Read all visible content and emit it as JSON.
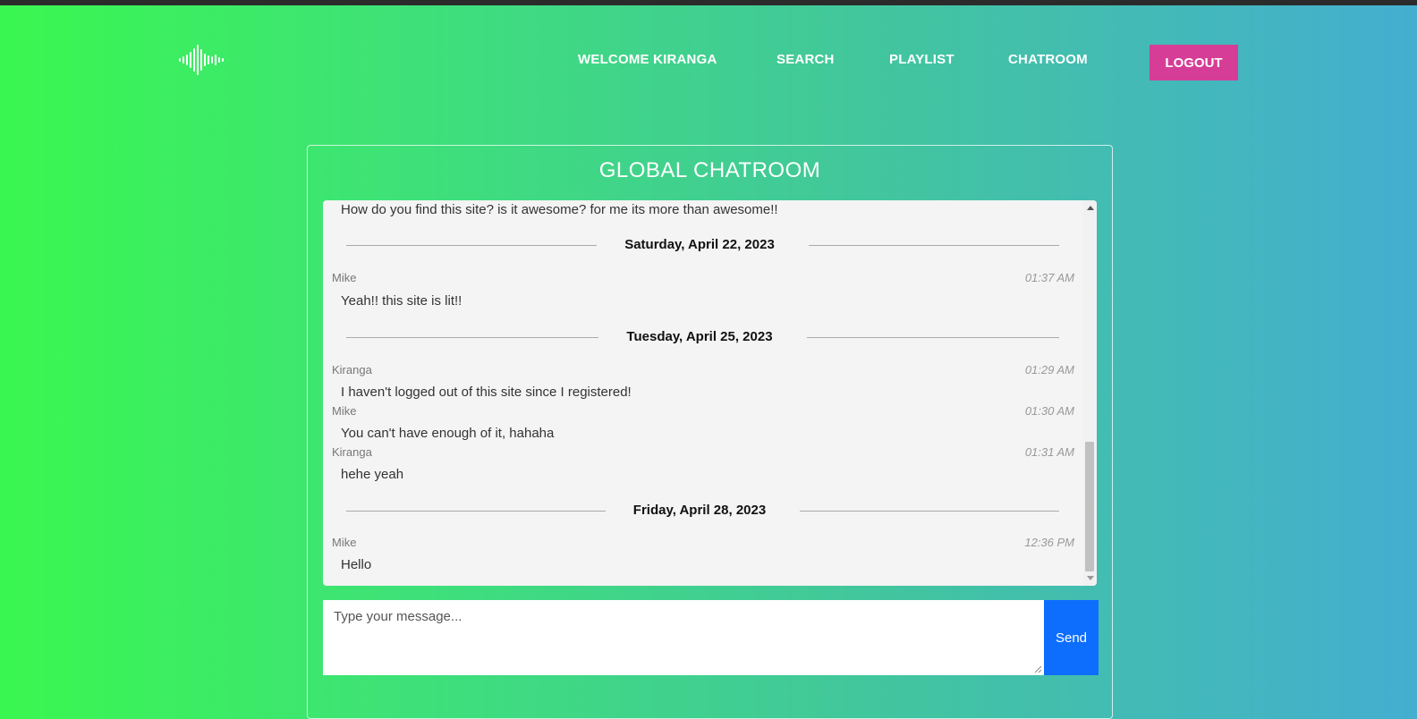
{
  "nav": {
    "welcome": "WELCOME KIRANGA",
    "search": "SEARCH",
    "playlist": "PLAYLIST",
    "chatroom": "CHATROOM",
    "logout": "LOGOUT"
  },
  "chat": {
    "title": "GLOBAL CHATROOM",
    "partial_message": "How do you find this site? is it awesome? for me its more than awesome!!",
    "dates": [
      "Saturday, April 22, 2023",
      "Tuesday, April 25, 2023",
      "Friday, April 28, 2023"
    ],
    "messages": [
      {
        "sender": "Mike",
        "time": "01:37 AM",
        "text": "Yeah!! this site is lit!!"
      },
      {
        "sender": "Kiranga",
        "time": "01:29 AM",
        "text": "I haven't logged out of this site since I registered!"
      },
      {
        "sender": "Mike",
        "time": "01:30 AM",
        "text": "You can't have enough of it, hahaha"
      },
      {
        "sender": "Kiranga",
        "time": "01:31 AM",
        "text": "hehe yeah"
      },
      {
        "sender": "Mike",
        "time": "12:36 PM",
        "text": "Hello"
      }
    ]
  },
  "composer": {
    "placeholder": "Type your message...",
    "send_label": "Send"
  },
  "icons": {
    "logo": "sound-wave-icon"
  },
  "colors": {
    "logout_bg": "#d63d96",
    "send_bg": "#0d6efd",
    "chat_bg": "#f4f4f4"
  }
}
